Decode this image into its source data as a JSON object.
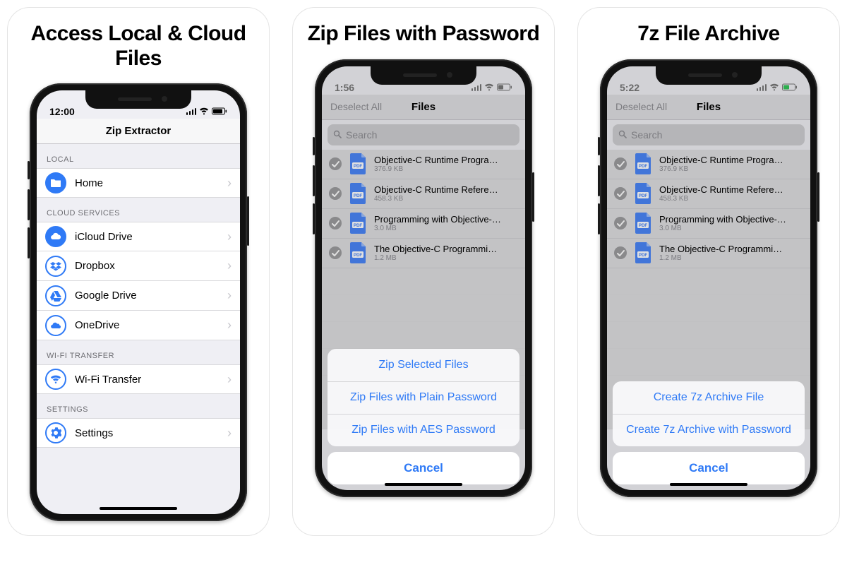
{
  "panels": [
    {
      "title": "Access Local & Cloud Files"
    },
    {
      "title": "Zip Files with Password"
    },
    {
      "title": "7z File Archive"
    }
  ],
  "screen1": {
    "time": "12:00",
    "nav_title": "Zip Extractor",
    "sections": {
      "local_header": "LOCAL",
      "cloud_header": "CLOUD SERVICES",
      "wifi_header": "WI-FI TRANSFER",
      "settings_header": "SETTINGS"
    },
    "rows": {
      "home": "Home",
      "icloud": "iCloud Drive",
      "dropbox": "Dropbox",
      "gdrive": "Google Drive",
      "onedrive": "OneDrive",
      "wifi": "Wi-Fi Transfer",
      "settings": "Settings"
    }
  },
  "screen2": {
    "time": "1:56",
    "nav_left": "Deselect All",
    "nav_title": "Files",
    "search_placeholder": "Search",
    "sheet": {
      "opt1": "Zip Selected Files",
      "opt2": "Zip Files with Plain Password",
      "opt3": "Zip Files with AES Password",
      "cancel": "Cancel"
    }
  },
  "screen3": {
    "time": "5:22",
    "nav_left": "Deselect All",
    "nav_title": "Files",
    "search_placeholder": "Search",
    "sheet": {
      "opt1": "Create 7z Archive File",
      "opt2": "Create 7z Archive with Password",
      "cancel": "Cancel"
    }
  },
  "files": [
    {
      "name": "Objective-C Runtime Programmin...",
      "size": "376.9 KB"
    },
    {
      "name": "Objective-C Runtime Reference.pdf",
      "size": "458.3 KB"
    },
    {
      "name": "Programming with Objective-C.pdf",
      "size": "3.0 MB"
    },
    {
      "name": "The Objective-C Programming Lan...",
      "size": "1.2 MB"
    }
  ]
}
